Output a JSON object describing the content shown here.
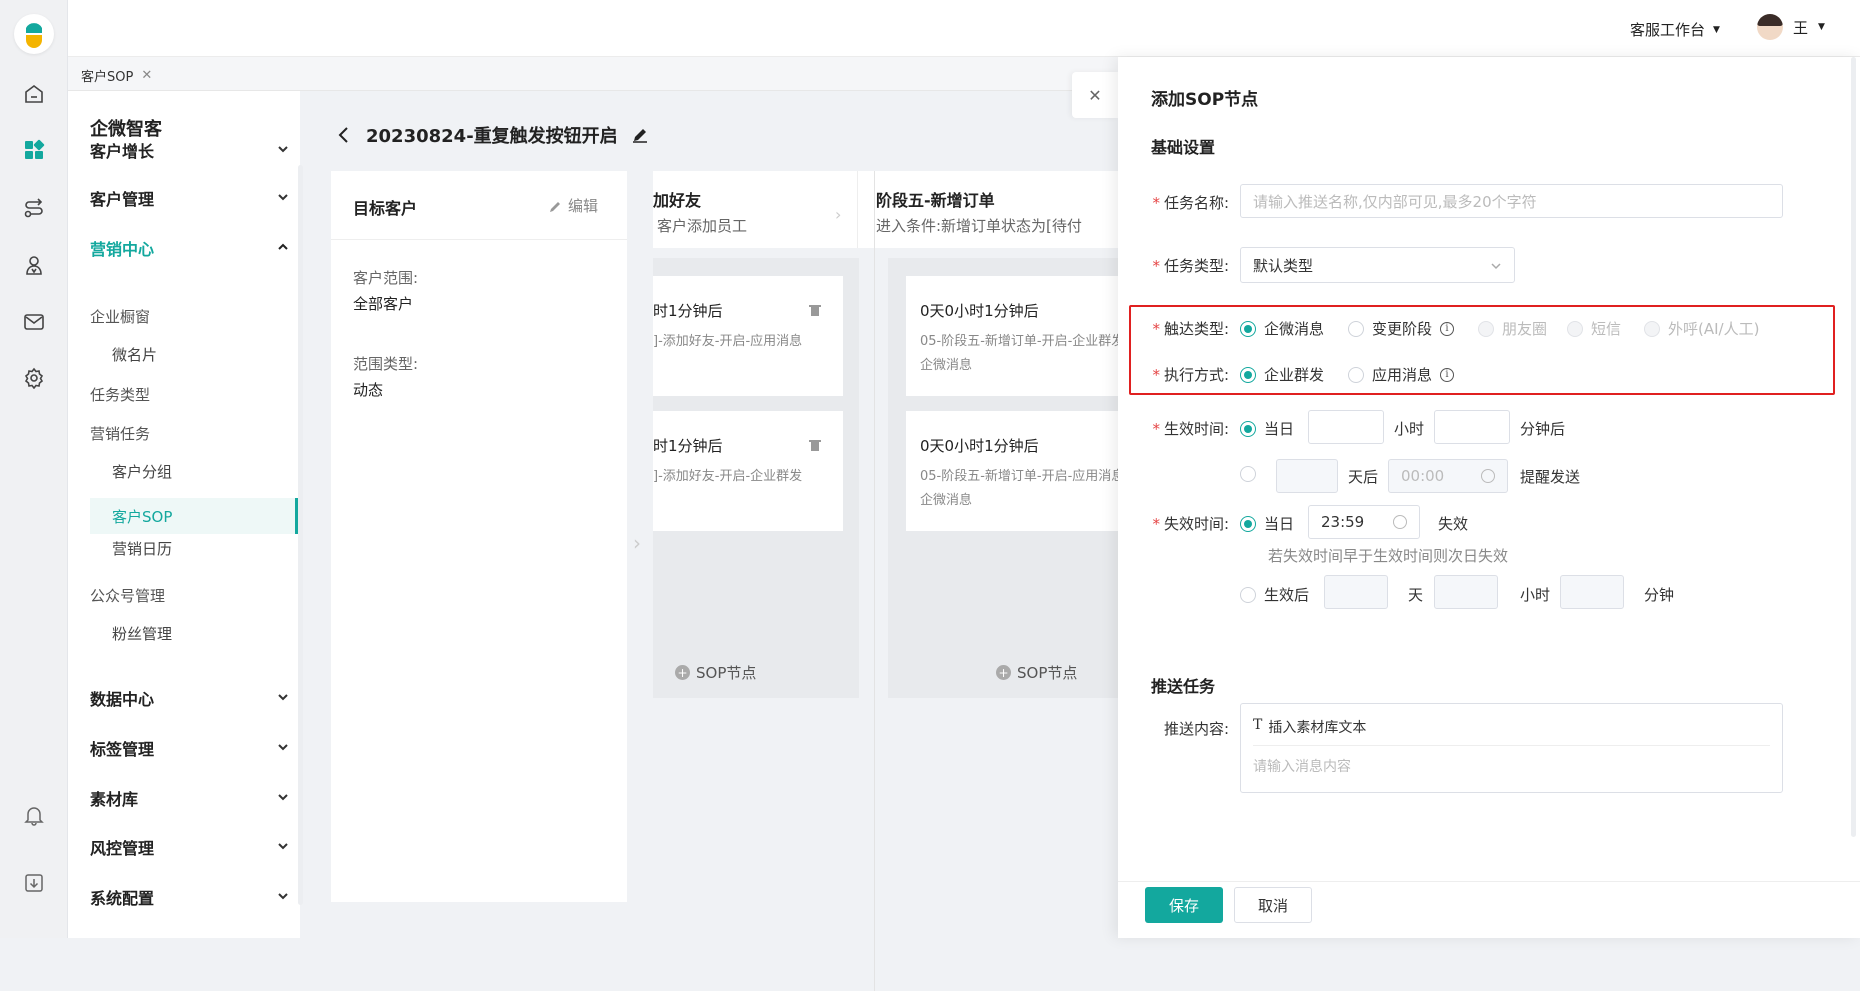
{
  "topbar": {
    "workspace": "客服工作台",
    "user": "王"
  },
  "tabs": [
    {
      "label": "客户SOP"
    }
  ],
  "sidebar": {
    "brand": "企微智客",
    "sections": {
      "growth": "客户增长",
      "manage": "客户管理",
      "marketing": "营销中心",
      "data": "数据中心",
      "tags": "标签管理",
      "materials": "素材库",
      "risk": "风控管理",
      "system": "系统配置"
    },
    "items": {
      "showcase": "企业橱窗",
      "card": "微名片",
      "task_type": "任务类型",
      "marketing_task": "营销任务",
      "group": "客户分组",
      "sop": "客户SOP",
      "calendar": "营销日历",
      "oa": "公众号管理",
      "fans": "粉丝管理"
    }
  },
  "content": {
    "title": "20230824-重复触发按钮开启",
    "target": {
      "title": "目标客户",
      "edit": "编辑",
      "range_label": "客户范围:",
      "range_value": "全部客户",
      "type_label": "范围类型:",
      "type_value": "动态"
    },
    "stage4": {
      "title": "加好友",
      "cond": "客户添加员工",
      "nodes": [
        {
          "time": "时1分钟后",
          "desc": "]-添加好友-开启-应用消息"
        },
        {
          "time": "时1分钟后",
          "desc": "]-添加好友-开启-企业群发"
        }
      ],
      "add": "SOP节点"
    },
    "stage5": {
      "title": "阶段五-新增订单",
      "cond": "进入条件:新增订单状态为[待付",
      "nodes": [
        {
          "time": "0天0小时1分钟后",
          "desc": "05-阶段五-新增订单-开启-企业群发",
          "desc2": "企微消息"
        },
        {
          "time": "0天0小时1分钟后",
          "desc": "05-阶段五-新增订单-开启-应用消息",
          "desc2": "企微消息"
        }
      ],
      "add": "SOP节点"
    }
  },
  "drawer": {
    "title": "添加SOP节点",
    "basic": "基础设置",
    "task_name_label": "任务名称:",
    "task_name_placeholder": "请输入推送名称,仅内部可见,最多20个字符",
    "task_type_label": "任务类型:",
    "task_type_value": "默认类型",
    "reach_label": "触达类型:",
    "reach_options": [
      "企微消息",
      "变更阶段",
      "朋友圈",
      "短信",
      "外呼(AI/人工)"
    ],
    "exec_label": "执行方式:",
    "exec_options": [
      "企业群发",
      "应用消息"
    ],
    "effective_label": "生效时间:",
    "same_day": "当日",
    "hour": "小时",
    "minute_after": "分钟后",
    "days_after": "天后",
    "time_placeholder": "00:00",
    "remind_send": "提醒发送",
    "expire_label": "失效时间:",
    "expire_time": "23:59",
    "expire_text": "失效",
    "expire_note": "若失效时间早于生效时间则次日失效",
    "after_effective": "生效后",
    "day": "天",
    "minute": "分钟",
    "push_task": "推送任务",
    "push_content_label": "推送内容:",
    "insert_text": "插入素材库文本",
    "msg_placeholder": "请输入消息内容",
    "save": "保存",
    "cancel": "取消"
  },
  "colors": {
    "accent": "#13a89e",
    "highlight": "#e02020"
  }
}
